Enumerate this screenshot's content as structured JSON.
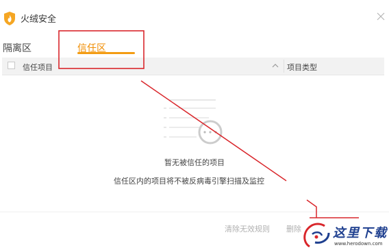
{
  "window": {
    "title": "火绒安全"
  },
  "tabs": [
    {
      "label": "隔离区",
      "active": false
    },
    {
      "label": "信任区",
      "active": true
    }
  ],
  "table": {
    "col_item": "信任项目",
    "col_type": "项目类型"
  },
  "empty_state": {
    "title": "暂无被信任的项目",
    "description": "信任区内的项目将不被反病毒引擎扫描及监控"
  },
  "footer": {
    "clear_invalid": "清除无效规则",
    "delete": "删除"
  },
  "watermark": {
    "text": "这里下载",
    "url": "www.herodown.com"
  },
  "colors": {
    "accent": "#f39c12",
    "annotation": "#d9262b",
    "watermark": "#1e3f8f"
  }
}
